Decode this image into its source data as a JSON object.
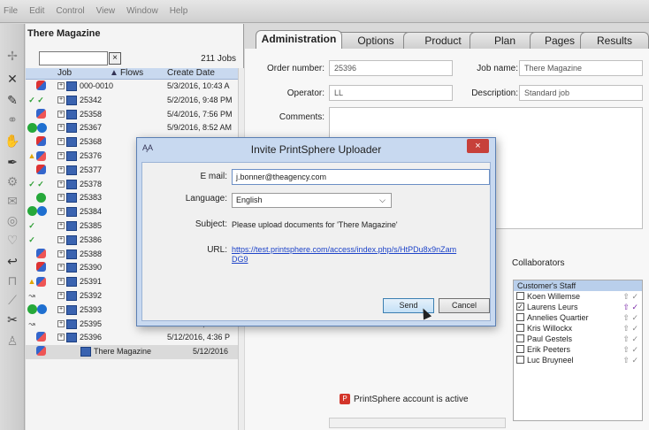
{
  "menubar": [
    "File",
    "Edit",
    "Control",
    "View",
    "Window",
    "Help"
  ],
  "left_panel": {
    "title": "There Magazine",
    "job_count": "211 Jobs",
    "search_clear": "×",
    "columns": [
      "Job",
      "Flows",
      "Create Date"
    ],
    "rows": [
      {
        "id": "000-0010",
        "date": "5/3/2016, 10:43 A",
        "status": "rb"
      },
      {
        "id": "25342",
        "date": "5/2/2016, 9:48 PM",
        "status": "check2"
      },
      {
        "id": "25358",
        "date": "5/4/2016, 7:56 PM",
        "status": "rb2"
      },
      {
        "id": "25367",
        "date": "5/9/2016, 8:52 AM",
        "status": "greenblue"
      },
      {
        "id": "25368",
        "date": "",
        "status": "rb"
      },
      {
        "id": "25376",
        "date": "",
        "status": "warn"
      },
      {
        "id": "25377",
        "date": "",
        "status": "rb"
      },
      {
        "id": "25378",
        "date": "",
        "status": "check2"
      },
      {
        "id": "25383",
        "date": "",
        "status": "green"
      },
      {
        "id": "25384",
        "date": "",
        "status": "greenblue"
      },
      {
        "id": "25385",
        "date": "",
        "status": "check"
      },
      {
        "id": "25386",
        "date": "",
        "status": "check"
      },
      {
        "id": "25388",
        "date": "",
        "status": "rb2"
      },
      {
        "id": "25390",
        "date": "",
        "status": "rb"
      },
      {
        "id": "25391",
        "date": "",
        "status": "warn"
      },
      {
        "id": "25392",
        "date": "",
        "status": "flow"
      },
      {
        "id": "25393",
        "date": "",
        "status": "greenblue"
      },
      {
        "id": "25395",
        "date": "5/12/2016, 4:33 P",
        "status": "flow"
      },
      {
        "id": "25396",
        "date": "5/12/2016, 4:36 P",
        "status": "rb2"
      }
    ],
    "selected_row": {
      "label": "There Magazine",
      "date": "5/12/2016"
    }
  },
  "tabs": [
    "Administration",
    "Options",
    "Product",
    "Plan",
    "Pages",
    "Results"
  ],
  "admin": {
    "order_number_label": "Order number:",
    "order_number": "25396",
    "job_name_label": "Job name:",
    "job_name": "There Magazine",
    "operator_label": "Operator:",
    "operator": "LL",
    "description_label": "Description:",
    "description": "Standard job",
    "comments_label": "Comments:"
  },
  "collaborators": {
    "label": "Collaborators",
    "header": "Customer's Staff",
    "people": [
      {
        "name": "Koen Willemse",
        "checked": false
      },
      {
        "name": "Laurens Leurs",
        "checked": true
      },
      {
        "name": "Annelies Quartier",
        "checked": false
      },
      {
        "name": "Kris Willockx",
        "checked": false
      },
      {
        "name": "Paul Gestels",
        "checked": false
      },
      {
        "name": "Erik Peeters",
        "checked": false
      },
      {
        "name": "Luc Bruyneel",
        "checked": false
      }
    ]
  },
  "printsphere_status": "PrintSphere account is active",
  "dialog": {
    "app_icon": "ĄA",
    "title": "Invite PrintSphere Uploader",
    "close": "×",
    "email_label": "E mail:",
    "email_value": "j.bonner@theagency.com",
    "language_label": "Language:",
    "language_value": "English",
    "subject_label": "Subject:",
    "subject_value": "Please upload documents for 'There Magazine'",
    "url_label": "URL:",
    "url_value": "https://test.printsphere.com/access/index.php/s/HtPDu8x9nZamDG9",
    "send_label": "Send",
    "cancel_label": "Cancel"
  }
}
